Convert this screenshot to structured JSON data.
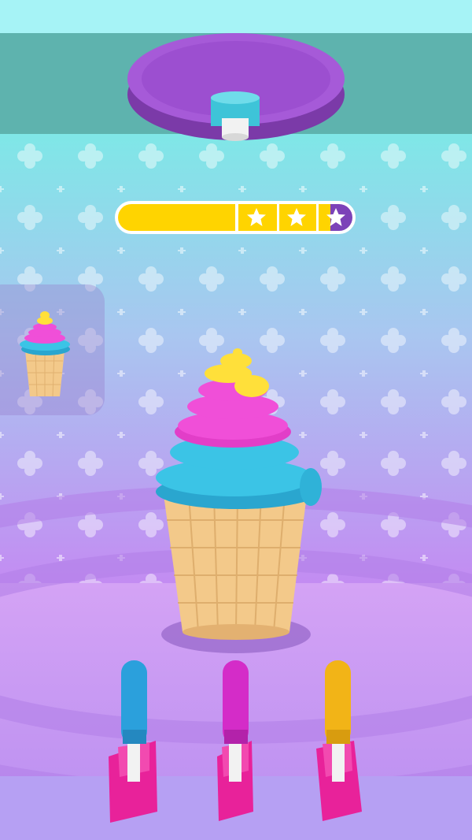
{
  "game": {
    "progress": 0.5,
    "stars_total": 3,
    "stars_earned": 3,
    "colors": {
      "sky": "#a6f3f6",
      "wall_top": "#5eb3ae",
      "wall_mid": "#8fe0e2",
      "wall_bottom": "#c08cf0",
      "floor": "#c99cf5",
      "bar_fill": "#ffd400",
      "bar_end": "#7c42b8",
      "cream_blue": "#3bc4e6",
      "cream_pink": "#f04fd8",
      "cream_yellow": "#ffe03a",
      "cone": "#f3c98a",
      "dispenser_disc": "#9d4fd0"
    },
    "dispensers": [
      {
        "name": "blue",
        "color": "#2ba0dc"
      },
      {
        "name": "pink",
        "color": "#d42cc8"
      },
      {
        "name": "yellow",
        "color": "#f2b417"
      }
    ],
    "icons": [
      "star-icon",
      "target-ice-cream-icon"
    ]
  }
}
